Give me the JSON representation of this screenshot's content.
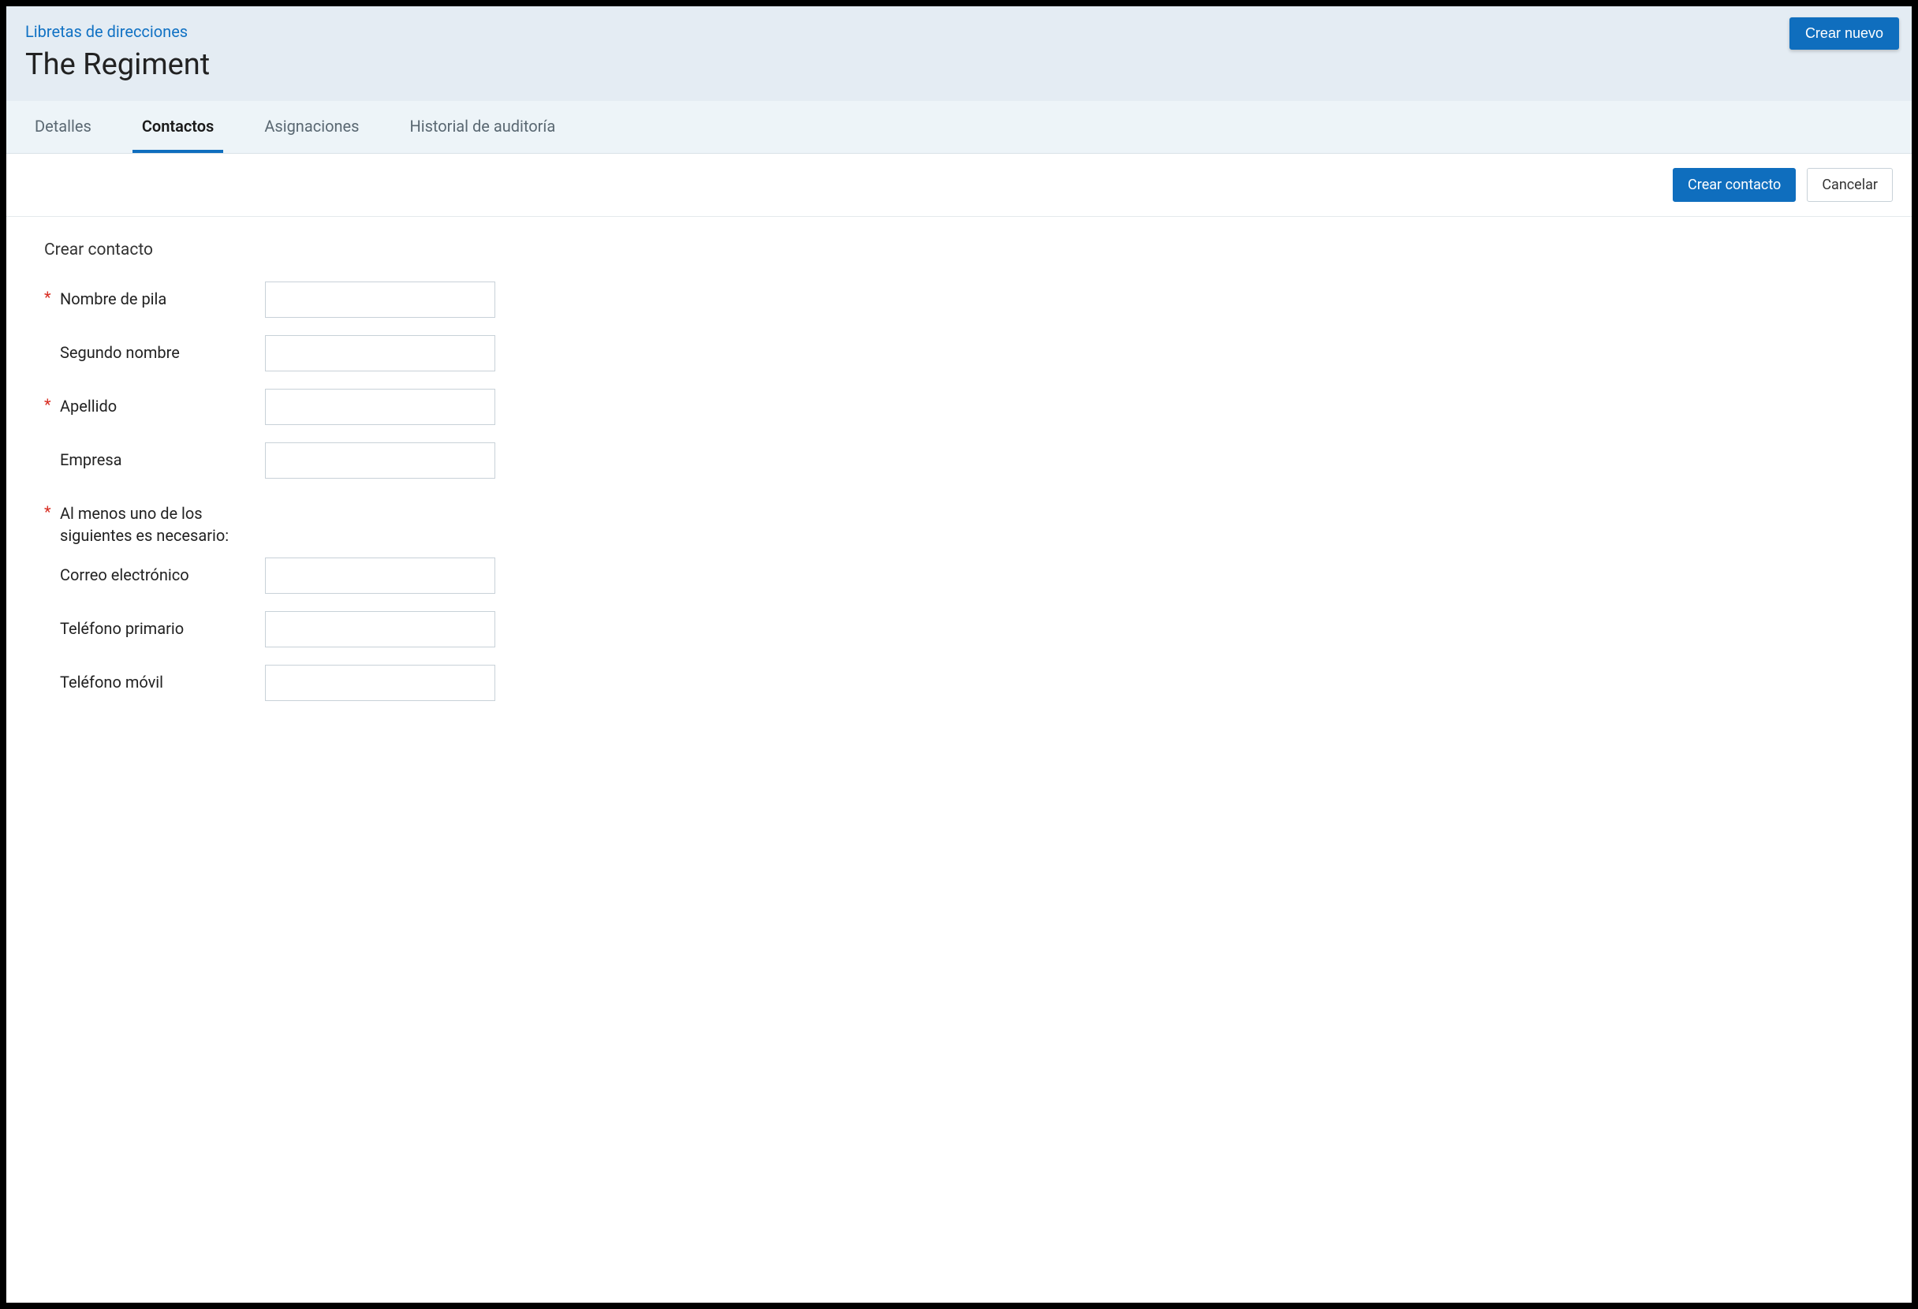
{
  "header": {
    "breadcrumb": "Libretas de direcciones",
    "title": "The Regiment",
    "create_new_label": "Crear nuevo"
  },
  "tabs": [
    {
      "label": "Detalles",
      "active": false
    },
    {
      "label": "Contactos",
      "active": true
    },
    {
      "label": "Asignaciones",
      "active": false
    },
    {
      "label": "Historial de auditoría",
      "active": false
    }
  ],
  "actions": {
    "create_contact_label": "Crear contacto",
    "cancel_label": "Cancelar"
  },
  "form": {
    "title": "Crear contacto",
    "required_mark": "*",
    "fields": {
      "first_name": {
        "label": "Nombre de pila",
        "required": true,
        "value": ""
      },
      "middle_name": {
        "label": "Segundo nombre",
        "required": false,
        "value": ""
      },
      "last_name": {
        "label": "Apellido",
        "required": true,
        "value": ""
      },
      "company": {
        "label": "Empresa",
        "required": false,
        "value": ""
      },
      "note": "Al menos uno de los siguientes es necesario:",
      "email": {
        "label": "Correo electrónico",
        "required": false,
        "value": ""
      },
      "primary_phone": {
        "label": "Teléfono primario",
        "required": false,
        "value": ""
      },
      "mobile_phone": {
        "label": "Teléfono móvil",
        "required": false,
        "value": ""
      }
    }
  }
}
